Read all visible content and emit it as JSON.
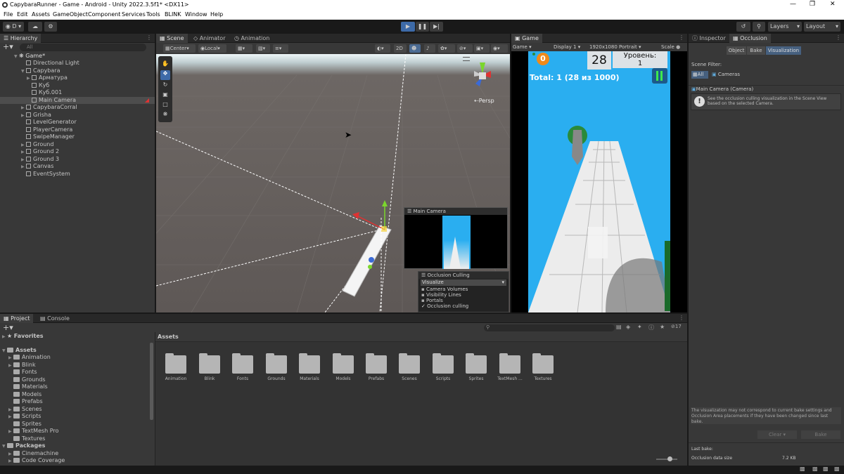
{
  "window": {
    "title": "CapybaraRunner - Game - Android - Unity 2022.3.5f1* <DX11>"
  },
  "menu": [
    "File",
    "Edit",
    "Assets",
    "GameObject",
    "Component",
    "Services",
    "Tools",
    "BLINK",
    "Window",
    "Help"
  ],
  "toolbar": {
    "account": "D",
    "layers": "Layers",
    "layout": "Layout"
  },
  "hierarchy": {
    "tab": "Hierarchy",
    "search_placeholder": "All",
    "items": [
      {
        "label": "Game*"
      },
      {
        "label": "Directional Light"
      },
      {
        "label": "Capybara"
      },
      {
        "label": "Арматура"
      },
      {
        "label": "Куб"
      },
      {
        "label": "Куб.001"
      },
      {
        "label": "Main Camera"
      },
      {
        "label": "CapybaraCorral"
      },
      {
        "label": "Grisha"
      },
      {
        "label": "LevelGenerator"
      },
      {
        "label": "PlayerCamera"
      },
      {
        "label": "SwipeManager"
      },
      {
        "label": "Ground"
      },
      {
        "label": "Ground 2"
      },
      {
        "label": "Ground 3"
      },
      {
        "label": "Canvas"
      },
      {
        "label": "EventSystem"
      }
    ]
  },
  "scene": {
    "tabs": [
      "Scene",
      "Animator",
      "Animation"
    ],
    "pivot": "Center",
    "space": "Local",
    "mode2d": "2D",
    "persp": "Persp",
    "camera_preview_title": "Main Camera",
    "occlusion": {
      "title": "Occlusion Culling",
      "mode": "Visualize",
      "options": [
        "Camera Volumes",
        "Visibility Lines",
        "Portals",
        "Occlusion culling"
      ]
    }
  },
  "game": {
    "tab": "Game",
    "view": "Game",
    "display": "Display 1",
    "resolution": "1920x1080 Portrait",
    "scale": "Scale",
    "coins": "0",
    "score": "28",
    "level_label": "Уровень:",
    "level_value": "1",
    "total": "Total: 1 (28 из 1000)"
  },
  "inspector": {
    "tabs": [
      "Inspector",
      "Occlusion"
    ],
    "subtabs": [
      "Object",
      "Bake",
      "Visualization"
    ],
    "scene_filter": "Scene Filter:",
    "filter_all": "All",
    "filter_cameras": "Cameras",
    "camera_title": "Main Camera (Camera)",
    "info": "See the occlusion culling visualization in the Scene View based on the selected Camera.",
    "warning": "The visualization may not correspond to current bake settings and Occlusion Area placements if they have been changed since last bake.",
    "clear": "Clear",
    "bake": "Bake",
    "last_bake": "Last bake:",
    "data_size_label": "Occlusion data size",
    "data_size_value": "7.2 KB"
  },
  "project": {
    "tabs": [
      "Project",
      "Console"
    ],
    "favorites": "Favorites",
    "tree": [
      "Assets",
      "Animation",
      "Blink",
      "Fonts",
      "Grounds",
      "Materials",
      "Models",
      "Prefabs",
      "Scenes",
      "Scripts",
      "Sprites",
      "TextMesh Pro",
      "Textures",
      "Packages",
      "Cinemachine",
      "Code Coverage"
    ],
    "breadcrumb": "Assets",
    "hidden_count": "17",
    "assets": [
      "Animation",
      "Blink",
      "Fonts",
      "Grounds",
      "Materials",
      "Models",
      "Prefabs",
      "Scenes",
      "Scripts",
      "Sprites",
      "TextMesh ...",
      "Textures"
    ]
  },
  "colors": {
    "accent": "#3d6aa8",
    "sky": "#2aaef0",
    "road": "#e8e8e8"
  }
}
